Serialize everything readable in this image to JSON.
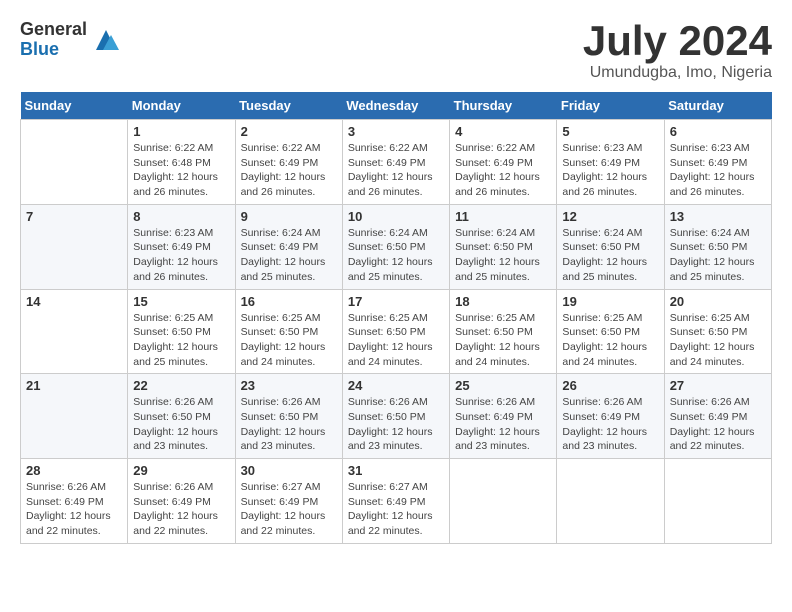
{
  "logo": {
    "general": "General",
    "blue": "Blue"
  },
  "title": "July 2024",
  "location": "Umundugba, Imo, Nigeria",
  "days_header": [
    "Sunday",
    "Monday",
    "Tuesday",
    "Wednesday",
    "Thursday",
    "Friday",
    "Saturday"
  ],
  "weeks": [
    [
      {
        "day": "",
        "info": ""
      },
      {
        "day": "1",
        "info": "Sunrise: 6:22 AM\nSunset: 6:48 PM\nDaylight: 12 hours and 26 minutes."
      },
      {
        "day": "2",
        "info": "Sunrise: 6:22 AM\nSunset: 6:49 PM\nDaylight: 12 hours and 26 minutes."
      },
      {
        "day": "3",
        "info": "Sunrise: 6:22 AM\nSunset: 6:49 PM\nDaylight: 12 hours and 26 minutes."
      },
      {
        "day": "4",
        "info": "Sunrise: 6:22 AM\nSunset: 6:49 PM\nDaylight: 12 hours and 26 minutes."
      },
      {
        "day": "5",
        "info": "Sunrise: 6:23 AM\nSunset: 6:49 PM\nDaylight: 12 hours and 26 minutes."
      },
      {
        "day": "6",
        "info": "Sunrise: 6:23 AM\nSunset: 6:49 PM\nDaylight: 12 hours and 26 minutes."
      }
    ],
    [
      {
        "day": "7",
        "info": ""
      },
      {
        "day": "8",
        "info": "Sunrise: 6:23 AM\nSunset: 6:49 PM\nDaylight: 12 hours and 26 minutes."
      },
      {
        "day": "9",
        "info": "Sunrise: 6:24 AM\nSunset: 6:49 PM\nDaylight: 12 hours and 25 minutes."
      },
      {
        "day": "10",
        "info": "Sunrise: 6:24 AM\nSunset: 6:50 PM\nDaylight: 12 hours and 25 minutes."
      },
      {
        "day": "11",
        "info": "Sunrise: 6:24 AM\nSunset: 6:50 PM\nDaylight: 12 hours and 25 minutes."
      },
      {
        "day": "12",
        "info": "Sunrise: 6:24 AM\nSunset: 6:50 PM\nDaylight: 12 hours and 25 minutes."
      },
      {
        "day": "13",
        "info": "Sunrise: 6:24 AM\nSunset: 6:50 PM\nDaylight: 12 hours and 25 minutes."
      }
    ],
    [
      {
        "day": "14",
        "info": ""
      },
      {
        "day": "15",
        "info": "Sunrise: 6:25 AM\nSunset: 6:50 PM\nDaylight: 12 hours and 25 minutes."
      },
      {
        "day": "16",
        "info": "Sunrise: 6:25 AM\nSunset: 6:50 PM\nDaylight: 12 hours and 24 minutes."
      },
      {
        "day": "17",
        "info": "Sunrise: 6:25 AM\nSunset: 6:50 PM\nDaylight: 12 hours and 24 minutes."
      },
      {
        "day": "18",
        "info": "Sunrise: 6:25 AM\nSunset: 6:50 PM\nDaylight: 12 hours and 24 minutes."
      },
      {
        "day": "19",
        "info": "Sunrise: 6:25 AM\nSunset: 6:50 PM\nDaylight: 12 hours and 24 minutes."
      },
      {
        "day": "20",
        "info": "Sunrise: 6:25 AM\nSunset: 6:50 PM\nDaylight: 12 hours and 24 minutes."
      }
    ],
    [
      {
        "day": "21",
        "info": ""
      },
      {
        "day": "22",
        "info": "Sunrise: 6:26 AM\nSunset: 6:50 PM\nDaylight: 12 hours and 23 minutes."
      },
      {
        "day": "23",
        "info": "Sunrise: 6:26 AM\nSunset: 6:50 PM\nDaylight: 12 hours and 23 minutes."
      },
      {
        "day": "24",
        "info": "Sunrise: 6:26 AM\nSunset: 6:50 PM\nDaylight: 12 hours and 23 minutes."
      },
      {
        "day": "25",
        "info": "Sunrise: 6:26 AM\nSunset: 6:49 PM\nDaylight: 12 hours and 23 minutes."
      },
      {
        "day": "26",
        "info": "Sunrise: 6:26 AM\nSunset: 6:49 PM\nDaylight: 12 hours and 23 minutes."
      },
      {
        "day": "27",
        "info": "Sunrise: 6:26 AM\nSunset: 6:49 PM\nDaylight: 12 hours and 22 minutes."
      }
    ],
    [
      {
        "day": "28",
        "info": "Sunrise: 6:26 AM\nSunset: 6:49 PM\nDaylight: 12 hours and 22 minutes."
      },
      {
        "day": "29",
        "info": "Sunrise: 6:26 AM\nSunset: 6:49 PM\nDaylight: 12 hours and 22 minutes."
      },
      {
        "day": "30",
        "info": "Sunrise: 6:27 AM\nSunset: 6:49 PM\nDaylight: 12 hours and 22 minutes."
      },
      {
        "day": "31",
        "info": "Sunrise: 6:27 AM\nSunset: 6:49 PM\nDaylight: 12 hours and 22 minutes."
      },
      {
        "day": "",
        "info": ""
      },
      {
        "day": "",
        "info": ""
      },
      {
        "day": "",
        "info": ""
      }
    ]
  ]
}
